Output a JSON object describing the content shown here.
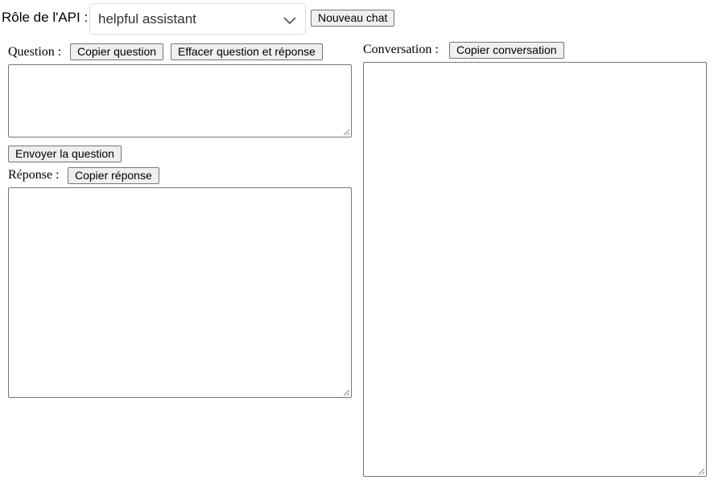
{
  "header": {
    "role_label": "Rôle de l'API :",
    "role_selected": "helpful assistant",
    "new_chat_label": "Nouveau chat"
  },
  "question": {
    "label": "Question :",
    "copy_label": "Copier question",
    "clear_label": "Effacer question et réponse",
    "value": "",
    "send_label": "Envoyer la question"
  },
  "response": {
    "label": "Réponse :",
    "copy_label": "Copier réponse",
    "value": ""
  },
  "conversation": {
    "label": "Conversation :",
    "copy_label": "Copier conversation",
    "value": ""
  },
  "icons": {
    "select_arrow": "chevron-down-icon",
    "resize_handle": "resize-grip-icon"
  },
  "colors": {
    "button_bg": "#efefef",
    "border": "#767676",
    "select_border": "#dcdcdc"
  }
}
